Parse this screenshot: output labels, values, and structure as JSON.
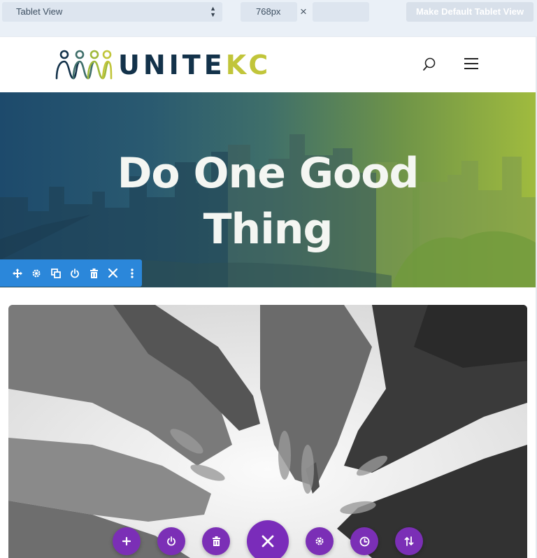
{
  "toolbar": {
    "view_select": "Tablet View",
    "width_value": "768px",
    "times_symbol": "×",
    "height_value": "",
    "default_button": "Make Default Tablet View"
  },
  "header": {
    "logo_main": "UNITE",
    "logo_accent": "KC",
    "icons": [
      "search-icon",
      "hamburger-menu-icon"
    ]
  },
  "hero": {
    "title_line1": "Do One Good",
    "title_line2": "Thing"
  },
  "section_toolbar": {
    "icons": [
      "move-icon",
      "gear-icon",
      "duplicate-icon",
      "power-icon",
      "trash-icon",
      "close-icon",
      "more-icon"
    ],
    "color": "#2b87da"
  },
  "row_toolbar": {
    "icons": [
      "plus-icon",
      "power-icon",
      "trash-icon",
      "close-icon",
      "gear-icon",
      "history-icon",
      "sort-icon"
    ],
    "color": "#7b2fb6"
  },
  "colors": {
    "logo_navy": "#13324a",
    "logo_lime": "#c1c53a"
  }
}
